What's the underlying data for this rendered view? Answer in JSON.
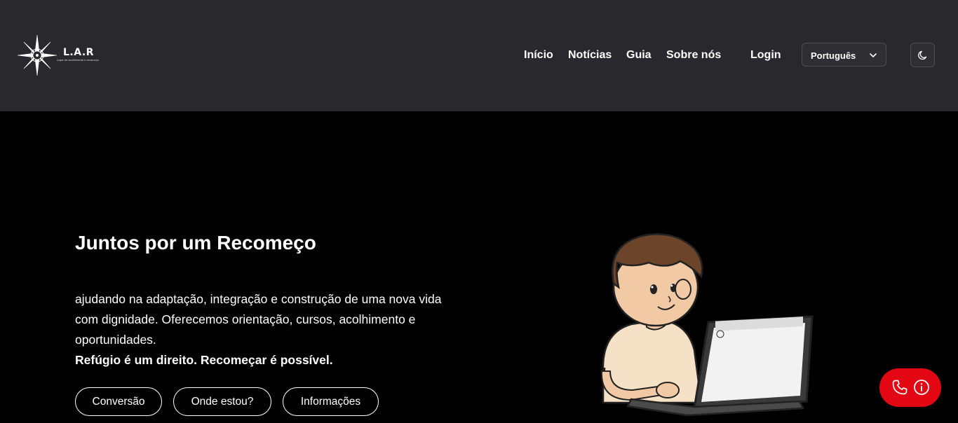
{
  "header": {
    "logo_title": "L.A.R",
    "logo_subtitle": "Lugar de acolhimento e recomeço",
    "nav": [
      "Início",
      "Notícias",
      "Guia",
      "Sobre nós"
    ],
    "login_label": "Login",
    "language": "Português"
  },
  "hero": {
    "title": "Juntos por um Recomeço",
    "body": "ajudando na adaptação, integração e construção de uma nova vida com dignidade. Oferecemos orientação, cursos, acolhimento e oportunidades.",
    "strong": "Refúgio é um direito. Recomeçar é possível.",
    "buttons": [
      "Conversão",
      "Onde estou?",
      "Informações"
    ]
  },
  "colors": {
    "header_bg": "#29292d",
    "page_bg": "#000000",
    "fab_bg": "#e30613"
  },
  "icons": [
    "compass-rose-logo",
    "chevron-down-icon",
    "moon-icon",
    "phone-icon",
    "info-icon"
  ]
}
